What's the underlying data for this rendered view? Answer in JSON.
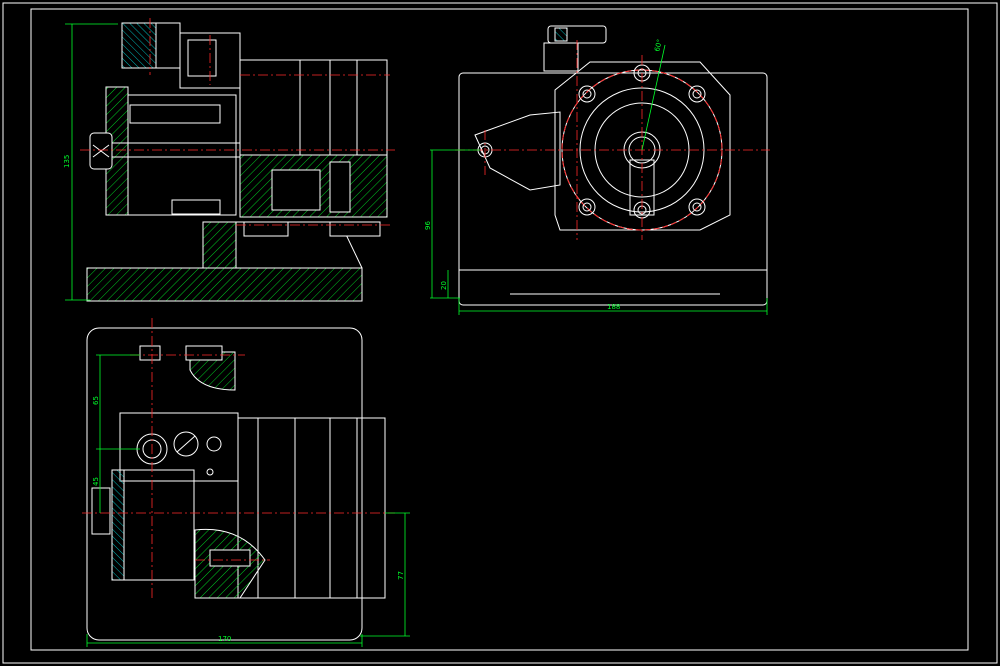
{
  "drawing": {
    "colors": {
      "background": "#000000",
      "outline": "#ffffff",
      "centerline": "#ff2a2a",
      "dimension": "#00ff2a",
      "section_hatch": "#00e5e5"
    },
    "dimensions": {
      "front_height": "135",
      "top_width": "188",
      "top_height": "96",
      "top_base": "20",
      "side_width": "170",
      "side_h1": "65",
      "side_h2": "45",
      "side_h3": "77",
      "angle": "60°"
    }
  }
}
